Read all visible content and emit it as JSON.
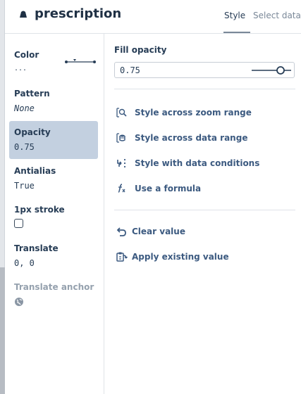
{
  "header": {
    "layer_name": "prescription",
    "tabs": [
      {
        "label": "Style",
        "active": true
      },
      {
        "label": "Select data",
        "active": false
      }
    ]
  },
  "sidebar": {
    "properties": [
      {
        "label": "Color",
        "value": "..."
      },
      {
        "label": "Pattern",
        "value": "None"
      },
      {
        "label": "Opacity",
        "value": "0.75",
        "selected": true
      },
      {
        "label": "Antialias",
        "value": "True"
      },
      {
        "label": "1px stroke",
        "checked": false
      },
      {
        "label": "Translate",
        "value": "0, 0"
      },
      {
        "label": "Translate anchor",
        "disabled": true
      }
    ]
  },
  "panel": {
    "title": "Fill opacity",
    "input_value": "0.75",
    "slider_value": 0.75,
    "actions": [
      {
        "label": "Style across zoom range"
      },
      {
        "label": "Style across data range"
      },
      {
        "label": "Style with data conditions"
      },
      {
        "label": "Use a formula"
      }
    ],
    "secondary_actions": [
      {
        "label": "Clear value"
      },
      {
        "label": "Apply existing value"
      }
    ]
  },
  "colors": {
    "accent": "#3c5a80",
    "text": "#273d56",
    "selected_bg": "#c3d0e0",
    "divider": "#dfe3e8"
  }
}
